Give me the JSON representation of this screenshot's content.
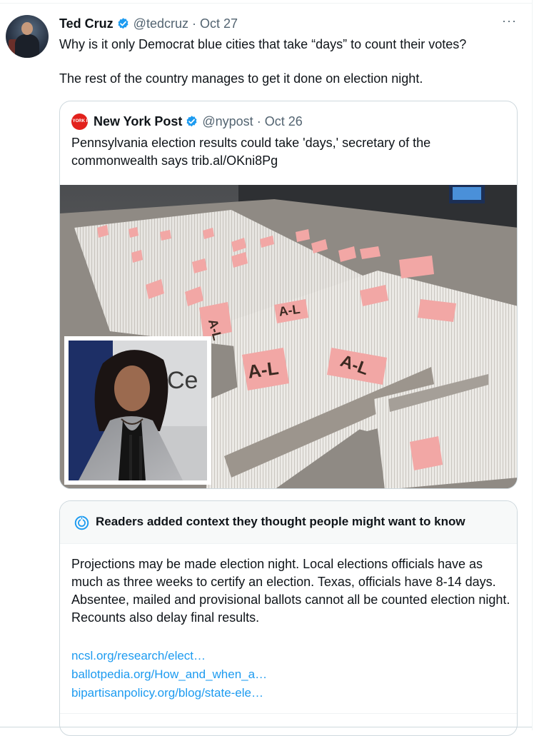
{
  "tweet": {
    "author_name": "Ted Cruz",
    "handle": "@tedcruz",
    "separator": "·",
    "date": "Oct 27",
    "more": "···",
    "text_line1": "Why is it only Democrat blue cities that take “days” to count their votes?",
    "text_line2": "The rest of the country manages to get it done on election night."
  },
  "quote": {
    "logo_text": "NEW YORK POST",
    "author_name": "New York Post",
    "handle": "@nypost",
    "separator": "·",
    "date": "Oct 26",
    "text": "Pennsylvania election results could take 'days,' secretary of the commonwealth says trib.al/OKni8Pg",
    "image_labels": [
      "A-L",
      "A-L",
      "A-L",
      "A-L"
    ]
  },
  "community_note": {
    "title": "Readers added context they thought people might want to know",
    "body": "Projections may be made election night. Local elections officials have as much as three weeks to certify an election. Texas, officials have 8-14 days. Absentee, mailed and provisional ballots cannot all be counted election night. Recounts also delay final results.",
    "links": [
      "ncsl.org/research/elect…",
      "ballotpedia.org/How_and_when_a…",
      "bipartisanpolicy.org/blog/state-ele…"
    ]
  },
  "colors": {
    "verified": "#1d9bf0",
    "link": "#1d9bf0",
    "secondary_text": "#536471",
    "nypost_red": "#e2211c"
  }
}
